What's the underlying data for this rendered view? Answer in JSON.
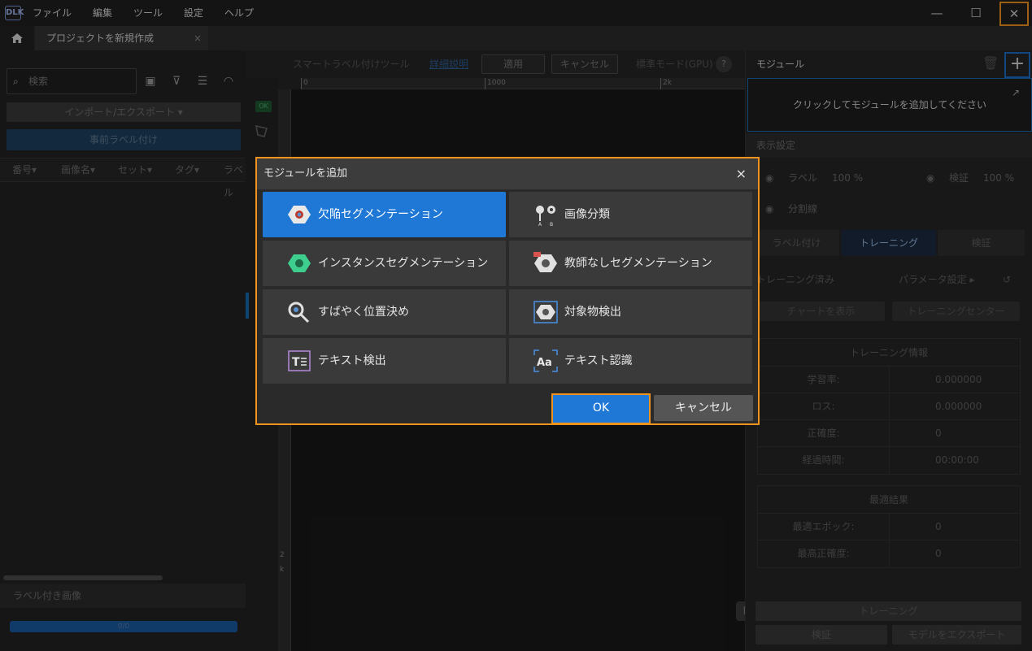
{
  "app": {
    "logo": "DLK"
  },
  "menubar": {
    "items": [
      "ファイル",
      "編集",
      "ツール",
      "設定",
      "ヘルプ"
    ]
  },
  "window": {
    "minimize": "—",
    "maximize": "☐",
    "close": "✕"
  },
  "tabs": {
    "project_tab": "プロジェクトを新規作成",
    "close": "×"
  },
  "left_panel": {
    "search_placeholder": "検索",
    "import_export": "インポート/エクスポート ▾",
    "pre_label": "事前ラベル付け",
    "columns": [
      "番号▾",
      "画像名▾",
      "セット▾",
      "タグ▾",
      "ラベル"
    ],
    "labeled_images": "ラベル付き画像",
    "progress_text": "0/0",
    "progress_fraction": 1.0
  },
  "center": {
    "tool_title": "スマートラベル付けツール",
    "help_link": "詳細説明",
    "apply": "適用",
    "cancel": "キャンセル",
    "mode": "標準モード(GPU)",
    "help_icon": "?",
    "ok_tag": "OK",
    "ruler_top": [
      "0",
      "1000",
      "2k"
    ],
    "ruler_left": [
      "2",
      "k"
    ]
  },
  "right_panel": {
    "title": "モジュール",
    "add_module_hint": "クリックしてモジュールを追加してください",
    "display_settings": "表示設定",
    "label_toggle": "ラベル",
    "label_pct": "100 %",
    "verify_toggle": "検証",
    "verify_pct": "100 %",
    "split_line": "分割線",
    "tabs": [
      "ラベル付け",
      "トレーニング",
      "検証"
    ],
    "trained": "トレーニング済み",
    "param_settings": "パラメータ設定 ▸",
    "show_chart": "チャートを表示",
    "training_center": "トレーニングセンター",
    "training_info": {
      "title": "トレーニング情報",
      "rows": [
        {
          "key": "学習率:",
          "value": "0.000000"
        },
        {
          "key": "ロス:",
          "value": "0.000000"
        },
        {
          "key": "正確度:",
          "value": "0"
        },
        {
          "key": "経過時間:",
          "value": "00:00:00"
        }
      ]
    },
    "best_result": {
      "title": "最適結果",
      "rows": [
        {
          "key": "最適エポック:",
          "value": "0"
        },
        {
          "key": "最高正確度:",
          "value": "0"
        }
      ]
    },
    "train_button": "トレーニング",
    "verify_button": "検証",
    "export_button": "モデルをエクスポート"
  },
  "dialog": {
    "title": "モジュールを追加",
    "close": "×",
    "modules": [
      {
        "label": "欠陥セグメンテーション",
        "icon": "defect-segmentation-icon",
        "selected": true
      },
      {
        "label": "画像分類",
        "icon": "image-classification-icon",
        "selected": false
      },
      {
        "label": "インスタンスセグメンテーション",
        "icon": "instance-segmentation-icon",
        "selected": false
      },
      {
        "label": "教師なしセグメンテーション",
        "icon": "unsupervised-segmentation-icon",
        "selected": false
      },
      {
        "label": "すばやく位置決め",
        "icon": "fast-positioning-icon",
        "selected": false
      },
      {
        "label": "対象物検出",
        "icon": "object-detection-icon",
        "selected": false
      },
      {
        "label": "テキスト検出",
        "icon": "text-detection-icon",
        "selected": false
      },
      {
        "label": "テキスト認識",
        "icon": "text-recognition-icon",
        "selected": false
      }
    ],
    "ok": "OK",
    "cancel": "キャンセル"
  },
  "colors": {
    "accent": "#1f78d6",
    "highlight": "#f0931e",
    "background": "#1e1e1e"
  }
}
